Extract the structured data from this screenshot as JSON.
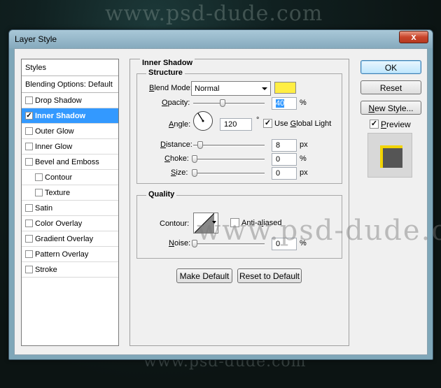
{
  "watermark": {
    "top": "www.psd-dude.com",
    "middle": "www.psd-dude.com",
    "bottom": "www.psd-dude.com"
  },
  "window": {
    "title": "Layer Style",
    "close_label": "x"
  },
  "style_list": {
    "header": "Styles",
    "blending": "Blending Options: Default",
    "items": [
      {
        "label": "Drop Shadow",
        "checked": false
      },
      {
        "label": "Inner Shadow",
        "checked": true,
        "selected": true
      },
      {
        "label": "Outer Glow",
        "checked": false
      },
      {
        "label": "Inner Glow",
        "checked": false
      },
      {
        "label": "Bevel and Emboss",
        "checked": false
      },
      {
        "label": "Contour",
        "checked": false,
        "sub": true
      },
      {
        "label": "Texture",
        "checked": false,
        "sub": true
      },
      {
        "label": "Satin",
        "checked": false
      },
      {
        "label": "Color Overlay",
        "checked": false
      },
      {
        "label": "Gradient Overlay",
        "checked": false
      },
      {
        "label": "Pattern Overlay",
        "checked": false
      },
      {
        "label": "Stroke",
        "checked": false
      }
    ],
    "check_mark": "✓"
  },
  "inner_shadow": {
    "title": "Inner Shadow",
    "structure_title": "Structure",
    "blend_mode_label": "Blend Mode:",
    "blend_mode_value": "Normal",
    "color": "#ffee44",
    "opacity_label": "Opacity:",
    "opacity_value": "40",
    "opacity_unit": "%",
    "angle_label": "Angle:",
    "angle_value": "120",
    "angle_unit": "°",
    "global_light_label": "Use Global Light",
    "global_light_checked": true,
    "distance_label": "Distance:",
    "distance_value": "8",
    "distance_unit": "px",
    "choke_label": "Choke:",
    "choke_value": "0",
    "choke_unit": "%",
    "size_label": "Size:",
    "size_value": "0",
    "size_unit": "px"
  },
  "quality": {
    "title": "Quality",
    "contour_label": "Contour:",
    "anti_aliased_label": "Anti-aliased",
    "anti_aliased_checked": false,
    "noise_label": "Noise:",
    "noise_value": "0",
    "noise_unit": "%"
  },
  "buttons": {
    "make_default": "Make Default",
    "reset_default": "Reset to Default",
    "ok": "OK",
    "reset": "Reset",
    "new_style": "New Style...",
    "preview_label": "Preview",
    "preview_checked": true
  }
}
